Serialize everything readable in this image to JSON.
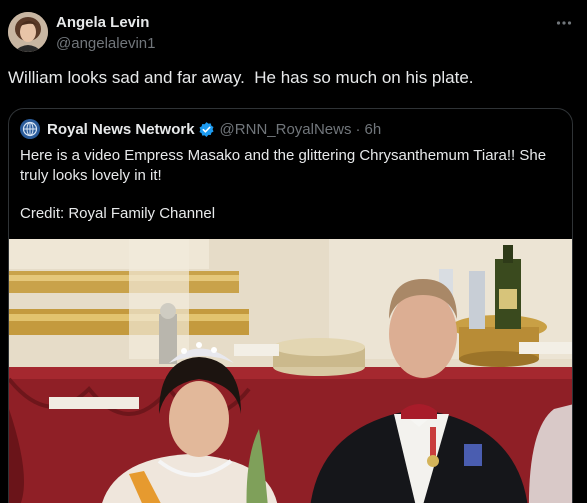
{
  "tweet": {
    "author_name": "Angela Levin",
    "author_handle": "@angelalevin1",
    "text": "William looks sad and far away.  He has so much on his plate.",
    "more_icon": "more-horizontal-icon"
  },
  "quote": {
    "author_name": "Royal News Network",
    "author_handle": "@RNN_RoyalNews",
    "separator": "·",
    "time": "6h",
    "text": "Here is a video Empress Masako and the glittering Chrysanthemum Tiara!! She truly looks lovely in it!",
    "credit": "Credit: Royal Family Channel",
    "verified_icon": "verified-badge-icon",
    "verified_color": "#1d9bf0"
  },
  "colors": {
    "background": "#000000",
    "text_primary": "#e7e9ea",
    "text_secondary": "#71767b",
    "border": "#2f3336"
  }
}
